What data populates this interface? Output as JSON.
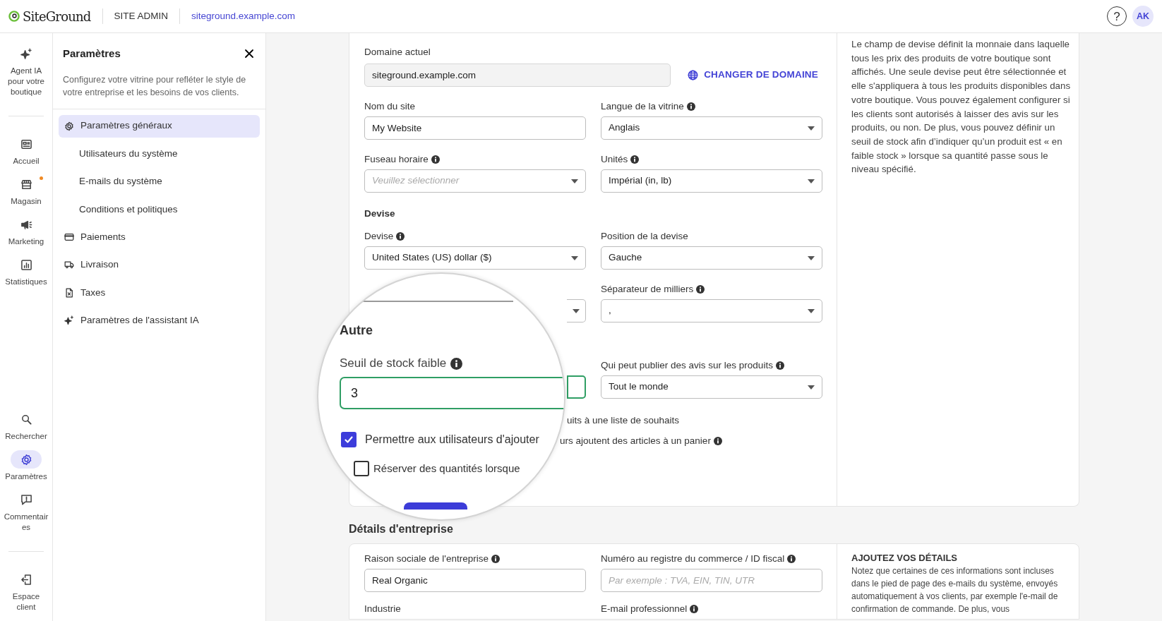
{
  "header": {
    "logo": "SiteGround",
    "app_label": "SITE ADMIN",
    "domain_link": "siteground.example.com",
    "help_label": "?",
    "avatar_initials": "AK"
  },
  "rail": {
    "top_items": [
      {
        "label": "Agent IA pour votre boutique",
        "selected": false,
        "badge": false
      }
    ],
    "main_items": [
      {
        "label": "Accueil",
        "selected": false,
        "badge": false
      },
      {
        "label": "Magasin",
        "selected": false,
        "badge": true
      },
      {
        "label": "Marketing",
        "selected": false,
        "badge": false
      },
      {
        "label": "Statistiques",
        "selected": false,
        "badge": false
      }
    ],
    "bottom_items": [
      {
        "label": "Rechercher",
        "selected": false,
        "badge": false
      },
      {
        "label": "Paramètres",
        "selected": true,
        "badge": false
      },
      {
        "label": "Commentaires",
        "selected": false,
        "badge": false
      }
    ],
    "footer_items": [
      {
        "label": "Espace client",
        "selected": false,
        "badge": false
      }
    ]
  },
  "settings_panel": {
    "title": "Paramètres",
    "description": "Configurez votre vitrine pour refléter le style de votre entreprise et les besoins de vos clients.",
    "items": [
      {
        "label": "Paramètres généraux",
        "kind": "main",
        "selected": true
      },
      {
        "label": "Utilisateurs du système",
        "kind": "sub",
        "selected": false
      },
      {
        "label": "E-mails du système",
        "kind": "sub",
        "selected": false
      },
      {
        "label": "Conditions et politiques",
        "kind": "sub",
        "selected": false
      },
      {
        "label": "Paiements",
        "kind": "main",
        "selected": false
      },
      {
        "label": "Livraison",
        "kind": "main",
        "selected": false
      },
      {
        "label": "Taxes",
        "kind": "main",
        "selected": false
      },
      {
        "label": "Paramètres de l'assistant IA",
        "kind": "main",
        "selected": false
      }
    ]
  },
  "general_card": {
    "domain": {
      "label": "Domaine actuel",
      "value": "siteground.example.com",
      "action": "CHANGER DE DOMAINE"
    },
    "rows": [
      {
        "kind": "fields",
        "fields": [
          {
            "label": "Nom du site",
            "info": false,
            "kind": "text",
            "value": "My Website"
          },
          {
            "label": "Langue de la vitrine",
            "info": true,
            "kind": "select",
            "value": "Anglais"
          }
        ]
      },
      {
        "kind": "fields",
        "fields": [
          {
            "label": "Fuseau horaire",
            "info": true,
            "kind": "select",
            "placeholder": "Veuillez sélectionner"
          },
          {
            "label": "Unités",
            "info": true,
            "kind": "select",
            "value": "Impérial (in, lb)"
          }
        ]
      },
      {
        "kind": "heading",
        "text": "Devise"
      },
      {
        "kind": "fields",
        "fields": [
          {
            "label": "Devise",
            "info": true,
            "kind": "select",
            "value": "United States (US) dollar ($)"
          },
          {
            "label": "Position de la devise",
            "info": false,
            "kind": "select",
            "value": "Gauche"
          }
        ]
      },
      {
        "kind": "fields",
        "fields": [
          {
            "kind": "select"
          },
          {
            "label": "Séparateur de milliers",
            "info": true,
            "kind": "select",
            "value": ","
          }
        ]
      },
      {
        "kind": "fields",
        "fields": [
          {
            "kind": "text",
            "focused": true
          },
          {
            "label": "Qui peut publier des avis sur les produits",
            "info": true,
            "kind": "select",
            "value": "Tout le monde"
          }
        ]
      }
    ],
    "partial_lines": [
      {
        "text": "uits à une liste de souhaits",
        "info": false
      },
      {
        "text": "urs ajoutent des articles à un panier",
        "info": true
      }
    ],
    "help_text": "Le champ de devise définit la monnaie dans laquelle tous les prix des produits de votre boutique sont affichés. Une seule devise peut être sélectionnée et elle s'appliquera à tous les produits disponibles dans votre boutique. Vous pouvez également configurer si les clients sont autorisés à laisser des avis sur les produits, ou non. De plus, vous pouvez définir un seuil de stock afin d’indiquer qu’un produit est « en faible stock » lorsque sa quantité passe sous le niveau spécifié."
  },
  "magnifier": {
    "heading": "Autre",
    "field_label": "Seuil de stock faible",
    "field_info": true,
    "field_value": "3",
    "field_focused": true,
    "checkboxes": [
      {
        "label": "Permettre aux utilisateurs d'ajouter",
        "checked": true
      },
      {
        "label": "Réserver des quantités lorsque",
        "checked": false
      }
    ]
  },
  "business_section": {
    "title": "Détails d'entreprise",
    "fields": [
      {
        "label": "Raison sociale de l'entreprise",
        "info": true,
        "kind": "text",
        "value": "Real Organic"
      },
      {
        "label": "Numéro au registre du commerce / ID fiscal",
        "info": true,
        "kind": "text",
        "placeholder": "Par exemple : TVA, EIN, TIN, UTR"
      }
    ],
    "next_labels": [
      {
        "label": "Industrie",
        "info": false
      },
      {
        "label": "E-mail professionnel",
        "info": true
      }
    ],
    "help_heading": "AJOUTEZ VOS DÉTAILS",
    "help_text": "Notez que certaines de ces informations sont incluses dans le pied de page des e-mails du système, envoyés automatiquement à vos clients, par exemple l'e-mail de confirmation de commande. De plus, vous"
  }
}
